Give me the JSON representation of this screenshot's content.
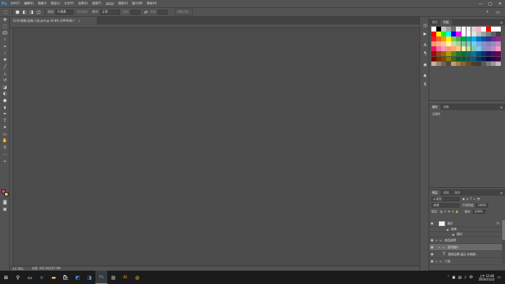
{
  "app": {
    "logo": "Ps"
  },
  "menu": [
    "文件(F)",
    "编辑(E)",
    "图像(I)",
    "图层(L)",
    "文字(Y)",
    "选择(S)",
    "滤镜(T)",
    "3D(D)",
    "视图(V)",
    "窗口(W)",
    "帮助(H)"
  ],
  "window_controls": {
    "minimize": "—",
    "maximize": "▢",
    "close": "✕"
  },
  "options_bar": {
    "feather_label": "羽化:",
    "feather_value": "0 像素",
    "antialias_label": "消除锯齿",
    "style_label": "样式:",
    "style_value": "正常",
    "width_label": "宽度:",
    "height_label": "高度:",
    "refine_label": "调整边缘..."
  },
  "document": {
    "tab_title": "1116-颐高-促销-二张.psd @ 43.8% (CMYK/8) *",
    "tab_close": "×",
    "zoom": "43.78%",
    "info": "文档: 393.1K/207.6M"
  },
  "swatches_panel": {
    "tabs": [
      "颜色",
      "色板"
    ],
    "active_tab": 1,
    "colors": [
      "#ffffff",
      "#000000",
      "#c8c8c8",
      "#a0a0a0",
      "#707070",
      "#e8e8e8",
      "#ffffff",
      "#eeeeee",
      "#e7c9e0",
      "#f2b5c8",
      "#ffffff",
      "#ff0000",
      "#ffffff",
      "#ffffff",
      "#ff0000",
      "#ffff00",
      "#00ff00",
      "#00ffff",
      "#0000ff",
      "#ff00ff",
      "#ffffff",
      "#ffffff",
      "#e0e0e0",
      "#c0c0c0",
      "#a0a0a0",
      "#808080",
      "#606060",
      "#404040",
      "#ed1c24",
      "#f26522",
      "#f7941d",
      "#fff200",
      "#8dc63f",
      "#39b54a",
      "#00a651",
      "#00a99d",
      "#00aeef",
      "#0072bc",
      "#0054a6",
      "#2e3192",
      "#662d91",
      "#92278f",
      "#f69679",
      "#f9ad81",
      "#fdc689",
      "#fff799",
      "#c4df9b",
      "#a3d39c",
      "#82ca9d",
      "#7accc8",
      "#6dcff6",
      "#7da7d9",
      "#8393ca",
      "#8781bd",
      "#a186be",
      "#bd8cbf",
      "#ed145b",
      "#f06eaa",
      "#f49ac1",
      "#f7977a",
      "#fbaf5d",
      "#fdc68a",
      "#fff79a",
      "#c4df9b",
      "#82ca9c",
      "#6ecff6",
      "#8493ca",
      "#a287bd",
      "#bc8dbf",
      "#f49ac2",
      "#9e0b0f",
      "#a0410d",
      "#a36209",
      "#aba000",
      "#598527",
      "#1a7b30",
      "#007236",
      "#00746b",
      "#0076a3",
      "#004b80",
      "#003471",
      "#1b1464",
      "#440e62",
      "#630460",
      "#790000",
      "#7b2e00",
      "#7d4900",
      "#827b00",
      "#406618",
      "#005e20",
      "#005826",
      "#005952",
      "#005b7f",
      "#003663",
      "#002157",
      "#0d004c",
      "#32004b",
      "#4b0049",
      "#c7b299",
      "#998675",
      "#736357",
      "#534741",
      "#c69c6d",
      "#a67c52",
      "#8c6239",
      "#754c24",
      "#603913",
      "#3c3c3c",
      "#5a5a5a",
      "#7a7a7a",
      "#9a9a9a",
      "#bdbdbd"
    ]
  },
  "properties_panel": {
    "tabs": [
      "属性",
      "调整"
    ],
    "text": "无属性"
  },
  "layers_panel": {
    "tabs": [
      "图层",
      "通道",
      "路径"
    ],
    "kind": "ρ 类型",
    "blend": "穿透",
    "opacity_label": "不透明度:",
    "opacity": "100%",
    "lock_label": "锁定:",
    "fill_label": "填充:",
    "fill": "100%",
    "layers": [
      {
        "name": "图片",
        "type": "image",
        "fx": "fx"
      },
      {
        "name": "效果",
        "type": "effect"
      },
      {
        "name": "描边",
        "type": "effect-sub"
      },
      {
        "name": "商品说明",
        "type": "group-open"
      },
      {
        "name": "宣传图片",
        "type": "group",
        "selected": true
      },
      {
        "name": "颐高品牌-晶石-价格颜...",
        "type": "text"
      },
      {
        "name": "六张",
        "type": "group"
      }
    ]
  },
  "taskbar": {
    "time": "上午 12:48",
    "date": "2016/11/22",
    "ime": "中"
  }
}
